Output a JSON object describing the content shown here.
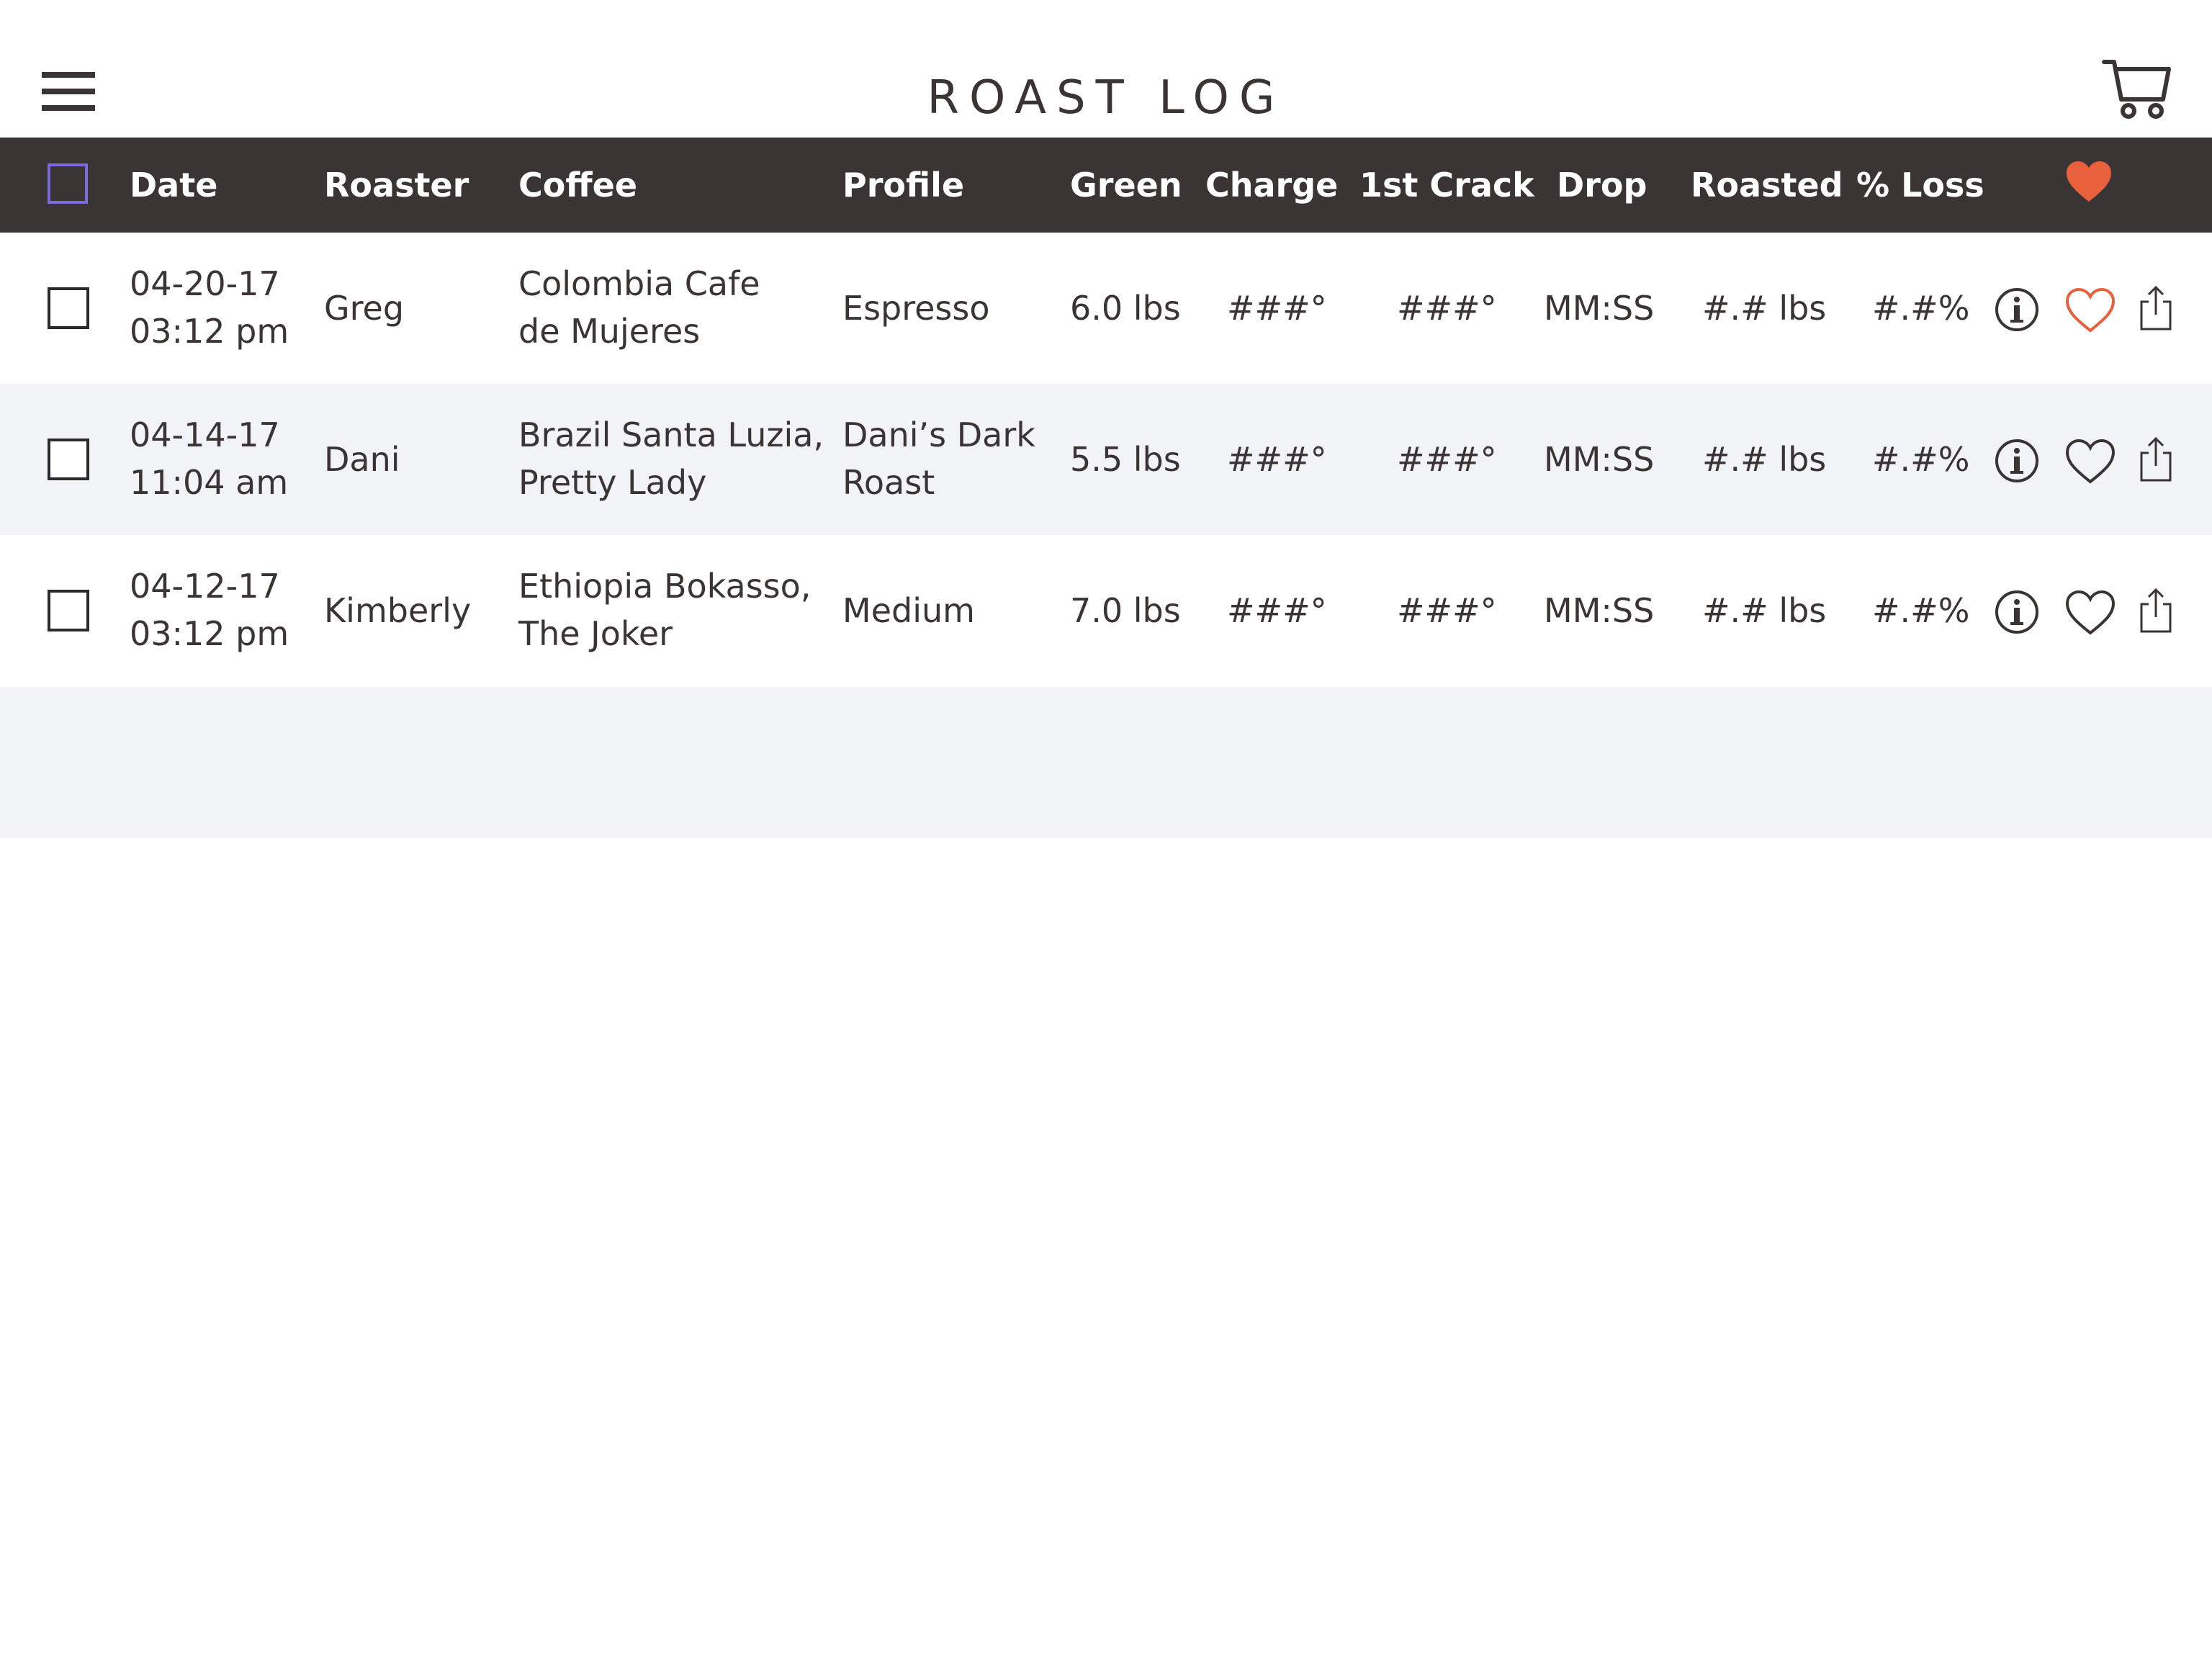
{
  "header": {
    "title": "ROAST LOG",
    "menu_icon": "hamburger-menu-icon",
    "cart_icon": "cart-icon"
  },
  "table": {
    "columns": [
      "Date",
      "Roaster",
      "Coffee",
      "Profile",
      "Green",
      "Charge",
      "1st Crack",
      "Drop",
      "Roasted",
      "% Loss"
    ],
    "favorite_header_icon": "heart-icon",
    "accent_color": "#e8603c",
    "header_bg": "#3b3434",
    "rows": [
      {
        "date": "04-20-17",
        "time": "03:12 pm",
        "roaster": "Greg",
        "coffee_line1": "Colombia Cafe",
        "coffee_line2": "de Mujeres",
        "profile_line1": "Espresso",
        "profile_line2": "",
        "green": "6.0 lbs",
        "charge": "###°",
        "first_crack": "###°",
        "drop": "MM:SS",
        "roasted": "#.# lbs",
        "loss": "#.#%",
        "favorited": true
      },
      {
        "date": "04-14-17",
        "time": "11:04 am",
        "roaster": "Dani",
        "coffee_line1": "Brazil Santa Luzia,",
        "coffee_line2": "Pretty Lady",
        "profile_line1": "Dani’s Dark",
        "profile_line2": "Roast",
        "green": "5.5 lbs",
        "charge": "###°",
        "first_crack": "###°",
        "drop": "MM:SS",
        "roasted": "#.# lbs",
        "loss": "#.#%",
        "favorited": false
      },
      {
        "date": "04-12-17",
        "time": "03:12 pm",
        "roaster": "Kimberly",
        "coffee_line1": "Ethiopia Bokasso,",
        "coffee_line2": "The Joker",
        "profile_line1": "Medium",
        "profile_line2": "",
        "green": "7.0 lbs",
        "charge": "###°",
        "first_crack": "###°",
        "drop": "MM:SS",
        "roasted": "#.# lbs",
        "loss": "#.#%",
        "favorited": false
      }
    ]
  }
}
